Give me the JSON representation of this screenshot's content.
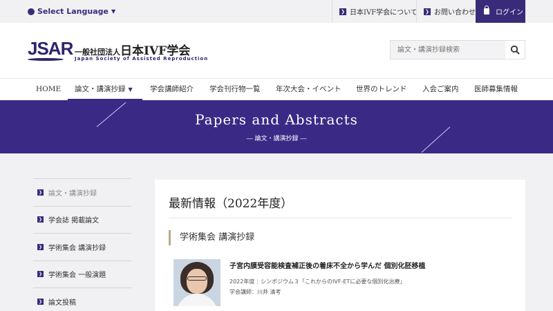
{
  "topbar": {
    "language": "Select Language",
    "links": [
      {
        "label": "日本IVF学会について"
      },
      {
        "label": "お問い合わせ"
      }
    ],
    "login": "ログイン"
  },
  "header": {
    "logo": "JSAR",
    "org_prefix": "一般社団法人",
    "org_name": "日本IVF学会",
    "org_en": "Japan Society of Assisted Reproduction",
    "search_placeholder": "論文・講演抄録検索"
  },
  "nav": {
    "items": [
      {
        "label": "HOME"
      },
      {
        "label": "論文・講演抄録"
      },
      {
        "label": "学会講師紹介"
      },
      {
        "label": "学会刊行物一覧"
      },
      {
        "label": "年次大会・イベント"
      },
      {
        "label": "世界のトレンド"
      },
      {
        "label": "入会ご案内"
      },
      {
        "label": "医師募集情報"
      }
    ]
  },
  "hero": {
    "title": "Papers and Abstracts",
    "subtitle": "― 論文・講演抄録 ―"
  },
  "sidebar": {
    "items": [
      {
        "label": "論文・講演抄録"
      },
      {
        "label": "学会誌 掲載論文"
      },
      {
        "label": "学術集会 講演抄録"
      },
      {
        "label": "学術集会 一般演題"
      },
      {
        "label": "論文投稿"
      }
    ]
  },
  "main": {
    "title": "最新情報（2022年度）",
    "section": "学術集会 講演抄録",
    "article": {
      "title": "子宮内膜受容能検査補正後の着床不全から学んだ 個別化胚移植",
      "year": "2022年度",
      "session": "シンポジウム３「これからのIVF-ETに必要な個別化治療」",
      "lecturer": "学会講師：川井 清考"
    }
  },
  "colors": {
    "brand": "#3a2a86",
    "accent_border": "#b9a98a"
  }
}
